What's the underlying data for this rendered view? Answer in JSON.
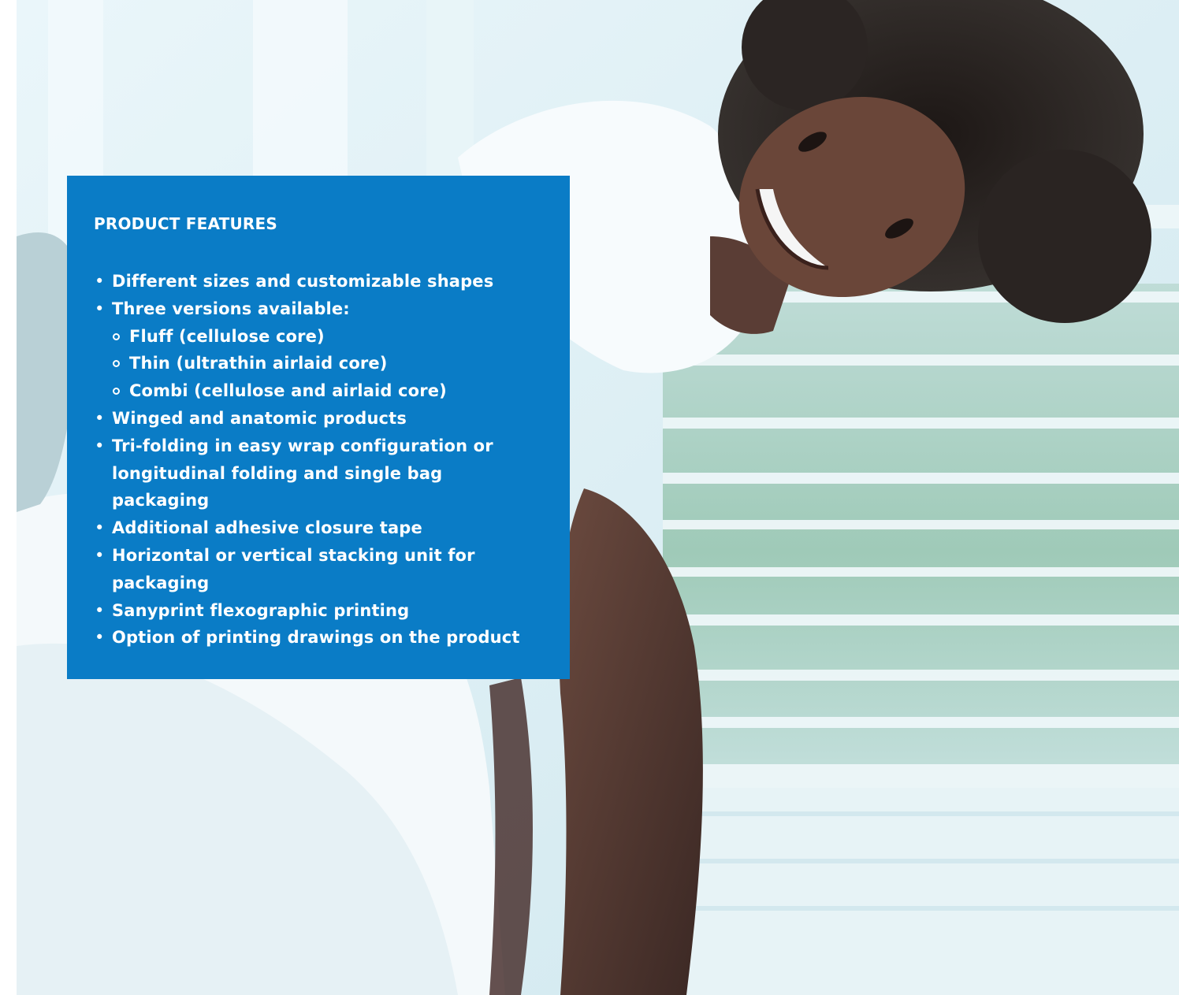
{
  "feature_box": {
    "title": "PRODUCT FEATURES",
    "bullet_glyph": "•",
    "items": [
      {
        "text": "Different sizes and customizable shapes"
      },
      {
        "text": "Three versions available:",
        "sub_items": [
          "Fluff (cellulose core)",
          "Thin (ultrathin airlaid core)",
          "Combi (cellulose and airlaid core)"
        ]
      },
      {
        "text": "Winged and anatomic products"
      },
      {
        "text": "Tri-folding in easy wrap configuration or longitudinal folding and single bag packaging"
      },
      {
        "text": "Additional adhesive closure tape"
      },
      {
        "text": "Horizontal or vertical stacking unit for packaging"
      },
      {
        "text": "Sanyprint flexographic printing"
      },
      {
        "text": "Option of  printing drawings on the product"
      }
    ]
  },
  "colors": {
    "box_blue": "#0a7cc6",
    "text": "#ffffff"
  }
}
